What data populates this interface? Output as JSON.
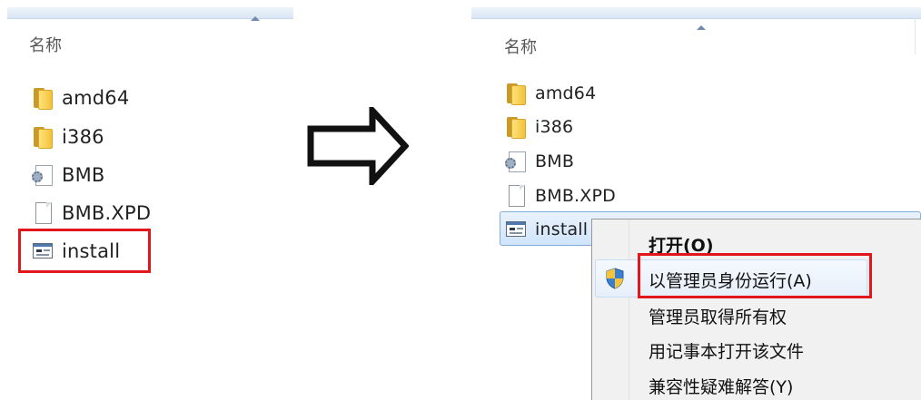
{
  "left_window": {
    "column_header": "名称",
    "items": [
      {
        "label": "amd64",
        "icon": "folder-icon"
      },
      {
        "label": "i386",
        "icon": "folder-icon"
      },
      {
        "label": "BMB",
        "icon": "settings-file-icon"
      },
      {
        "label": "BMB.XPD",
        "icon": "blank-file-icon"
      },
      {
        "label": "install",
        "icon": "batch-file-icon"
      }
    ]
  },
  "right_window": {
    "column_header": "名称",
    "items": [
      {
        "label": "amd64",
        "icon": "folder-icon"
      },
      {
        "label": "i386",
        "icon": "folder-icon"
      },
      {
        "label": "BMB",
        "icon": "settings-file-icon"
      },
      {
        "label": "BMB.XPD",
        "icon": "blank-file-icon"
      },
      {
        "label": "install",
        "icon": "batch-file-icon"
      }
    ]
  },
  "context_menu": {
    "items": [
      {
        "label": "打开(O)",
        "bold": true
      },
      {
        "label": "以管理员身份运行(A)",
        "icon": "uac-shield-icon"
      },
      {
        "label": "管理员取得所有权"
      },
      {
        "label": "用记事本打开该文件"
      },
      {
        "label": "兼容性疑难解答(Y)"
      }
    ]
  },
  "colors": {
    "highlight": "#e2171b",
    "selection": "#cfe4fb"
  }
}
